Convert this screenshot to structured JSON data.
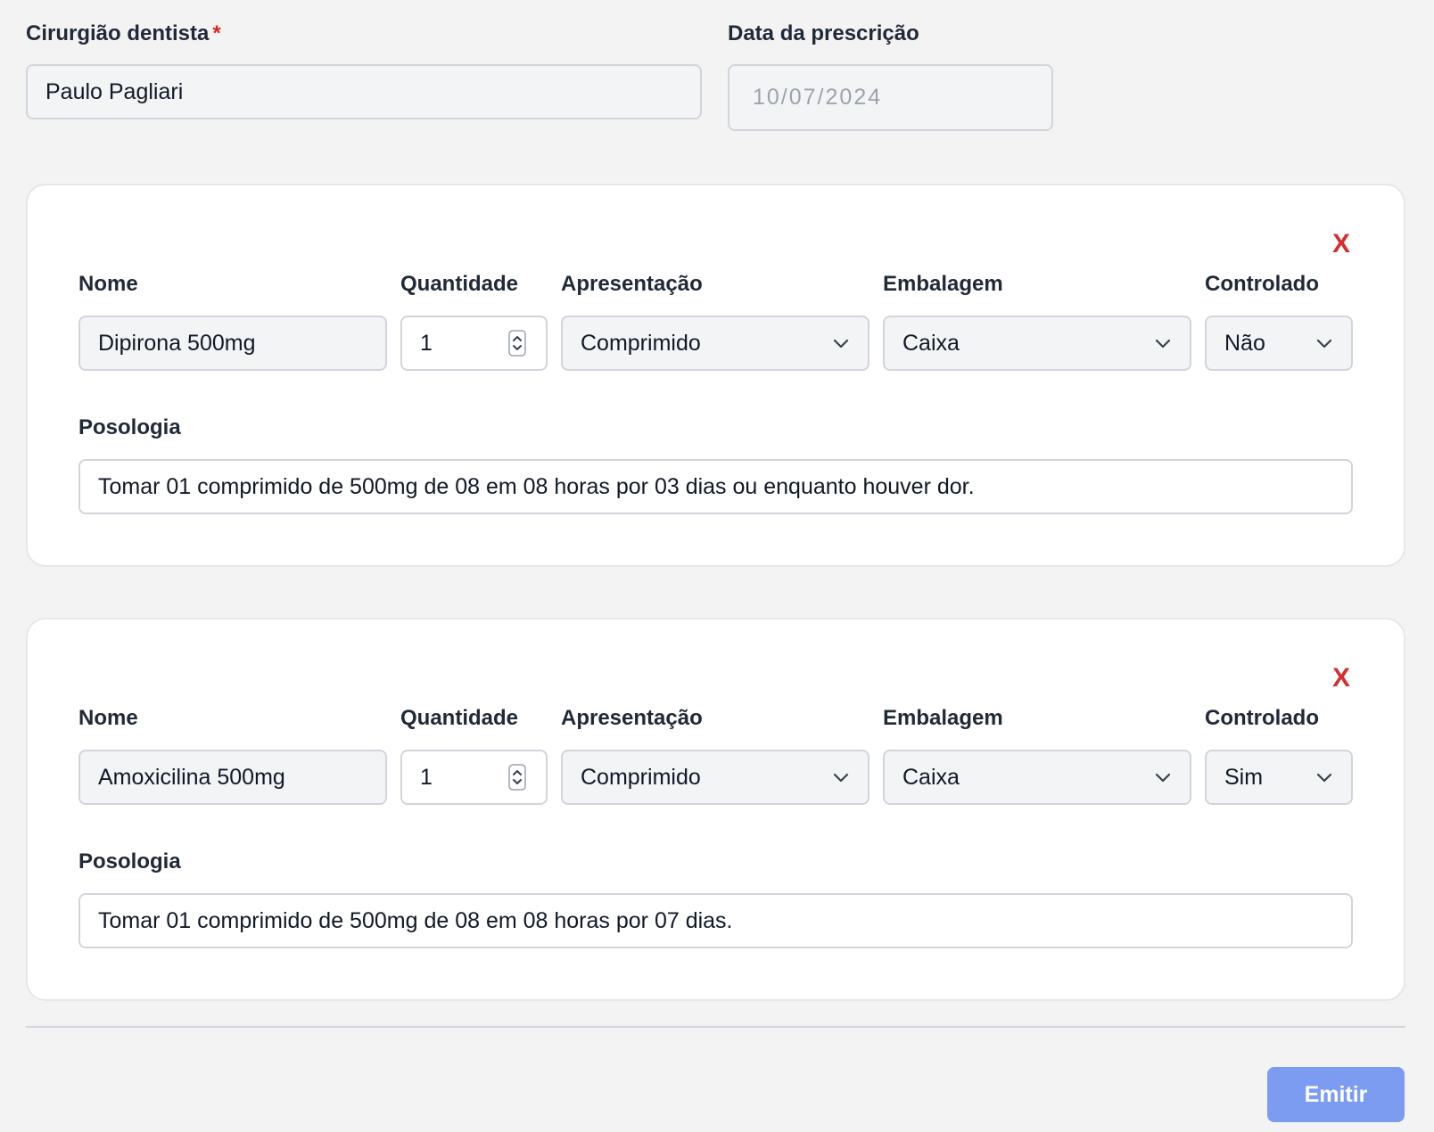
{
  "header": {
    "dentist_label": "Cirurgião dentista",
    "required_mark": "*",
    "dentist_value": "Paulo Pagliari",
    "date_label": "Data da prescrição",
    "date_value": "10/07/2024"
  },
  "prescriptions": [
    {
      "remove_label": "X",
      "nome_label": "Nome",
      "nome_value": "Dipirona 500mg",
      "quantidade_label": "Quantidade",
      "quantidade_value": "1",
      "apresentacao_label": "Apresentação",
      "apresentacao_value": "Comprimido",
      "embalagem_label": "Embalagem",
      "embalagem_value": "Caixa",
      "controlado_label": "Controlado",
      "controlado_value": "Não",
      "posologia_label": "Posologia",
      "posologia_value": "Tomar 01 comprimido de 500mg de 08 em 08 horas por 03 dias ou enquanto houver dor."
    },
    {
      "remove_label": "X",
      "nome_label": "Nome",
      "nome_value": "Amoxicilina 500mg",
      "quantidade_label": "Quantidade",
      "quantidade_value": "1",
      "apresentacao_label": "Apresentação",
      "apresentacao_value": "Comprimido",
      "embalagem_label": "Embalagem",
      "embalagem_value": "Caixa",
      "controlado_label": "Controlado",
      "controlado_value": "Sim",
      "posologia_label": "Posologia",
      "posologia_value": "Tomar 01 comprimido de 500mg de 08 em 08 horas por 07 dias."
    }
  ],
  "footer": {
    "emit_label": "Emitir"
  },
  "colors": {
    "accent": "#7b9cf0",
    "remove": "#d32f2f",
    "required": "#dc2626"
  }
}
